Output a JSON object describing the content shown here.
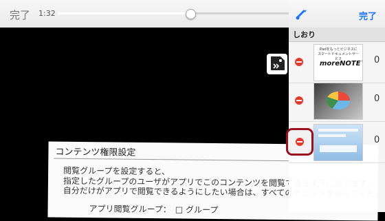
{
  "player": {
    "done_label": "完了",
    "elapsed": "1:32",
    "progress_fraction": 0.46
  },
  "document": {
    "heading": "コンテンツ権限設定",
    "lines": [
      "閲覧グループを設定すると、",
      "指定したグループのユーザがアプリでこのコンテンツを閲覧できるようになります。",
      "自分だけがアプリで閲覧できるようにしたい場合は、すべてのチェックを外してください。",
      "アプリ閲覧グループ：　□ グループ"
    ]
  },
  "panel": {
    "done_label": "完了",
    "section_title": "しおり",
    "accent_color": "#1e74f5",
    "delete_color": "#e03a2f",
    "rows": [
      {
        "thumbnail_caption": "iPadをもっとビジネスに スマートドキュメントサービス",
        "thumbnail_logo": "moreNOTE™",
        "count": "0"
      },
      {
        "thumbnail_kind": "photo-pie-chart",
        "count": "0"
      },
      {
        "thumbnail_kind": "slide",
        "count": "0"
      }
    ]
  },
  "icons": {
    "toolbar_tool": "brush-icon",
    "bookmark_tag": "bookmark-tag-icon"
  }
}
